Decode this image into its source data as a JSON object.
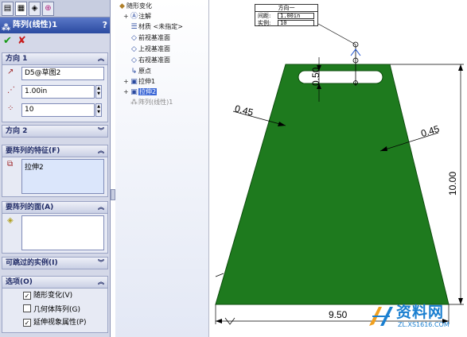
{
  "property_manager": {
    "title": "阵列(线性)1",
    "help": "?",
    "ok_icon": "check-icon",
    "cancel_icon": "x-icon",
    "direction1": {
      "label": "方向 1",
      "reference": "D5@草图2",
      "spacing": "1.00in",
      "count": "10"
    },
    "direction2": {
      "label": "方向 2"
    },
    "features_to_pattern": {
      "label": "要阵列的特征(F)",
      "items": [
        "拉伸2"
      ]
    },
    "faces_to_pattern": {
      "label": "要阵列的面(A)"
    },
    "instances_to_skip": {
      "label": "可跳过的实例(I)"
    },
    "options": {
      "label": "选项(O)",
      "items": [
        {
          "label": "随形变化(V)",
          "checked": true
        },
        {
          "label": "几何体阵列(G)",
          "checked": false
        },
        {
          "label": "延伸视象属性(P)",
          "checked": true
        }
      ]
    }
  },
  "feature_tree": {
    "items": [
      {
        "label": "随形变化",
        "icon": "part-icon"
      },
      {
        "label": "注解",
        "icon": "annotation-icon"
      },
      {
        "label": "材质 <未指定>",
        "icon": "material-icon"
      },
      {
        "label": "前视基准面",
        "icon": "plane-icon"
      },
      {
        "label": "上视基准面",
        "icon": "plane-icon"
      },
      {
        "label": "右视基准面",
        "icon": "plane-icon"
      },
      {
        "label": "原点",
        "icon": "origin-icon"
      },
      {
        "label": "拉伸1",
        "icon": "extrude-icon"
      },
      {
        "label": "拉伸2",
        "icon": "extrude-icon"
      },
      {
        "label": "阵列(线性)1",
        "icon": "pattern-icon"
      }
    ]
  },
  "viewport": {
    "callout": {
      "title": "方向一",
      "spacing_label": "间距:",
      "spacing_value": "1.00in",
      "count_label": "实例:",
      "count_value": "10"
    },
    "dimensions": {
      "left_offset": "0.45",
      "right_offset": "0.45",
      "slot_height": "0.50",
      "height": "10.00",
      "bottom_width": "9.50"
    },
    "part_color": "#1e7a1e"
  },
  "watermark": {
    "title": "资料网",
    "url": "ZL.XS1616.COM"
  }
}
